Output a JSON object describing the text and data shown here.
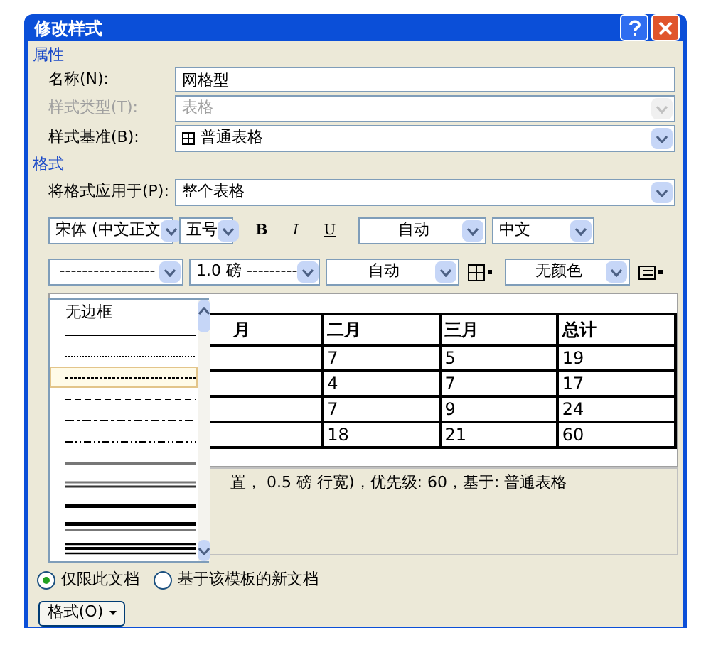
{
  "window": {
    "title": "修改样式"
  },
  "properties": {
    "heading": "属性",
    "name": {
      "label": "名称(N):",
      "value": "网格型"
    },
    "style_type": {
      "label": "样式类型(T):",
      "value": "表格",
      "disabled": true
    },
    "based_on": {
      "label": "样式基准(B):",
      "value": "普通表格"
    }
  },
  "format": {
    "heading": "格式",
    "apply_to": {
      "label": "将格式应用于(P):",
      "value": "整个表格"
    }
  },
  "toolbar": {
    "font": "宋体 (中文正文",
    "size": "五号",
    "bold": "B",
    "italic": "I",
    "underline": "U",
    "text_color": "自动",
    "language": "中文"
  },
  "border_bar": {
    "line_style": "-----------------",
    "width": "1.0 磅 ---------",
    "border_color": "自动",
    "shading": "无颜色"
  },
  "line_style_list": [
    {
      "kind": "text",
      "label": "无边框",
      "selected": false
    },
    {
      "kind": "line",
      "selected": false
    },
    {
      "kind": "line",
      "selected": false
    },
    {
      "kind": "line",
      "selected": true
    },
    {
      "kind": "line",
      "selected": false
    },
    {
      "kind": "line",
      "selected": false
    },
    {
      "kind": "line",
      "selected": false
    },
    {
      "kind": "line",
      "selected": false
    },
    {
      "kind": "line",
      "selected": false
    },
    {
      "kind": "line",
      "selected": false
    },
    {
      "kind": "line",
      "selected": false
    },
    {
      "kind": "line",
      "selected": false
    }
  ],
  "preview_table": {
    "columns": [
      "月",
      "二月",
      "三月",
      "总计"
    ],
    "rows": [
      [
        "",
        "7",
        "5",
        "19"
      ],
      [
        "",
        "4",
        "7",
        "17"
      ],
      [
        "",
        "7",
        "9",
        "24"
      ],
      [
        "",
        "18",
        "21",
        "60"
      ]
    ]
  },
  "description": "置， 0.5 磅 行宽)，优先级: 60，基于: 普通表格",
  "scope": [
    {
      "label": "仅限此文档",
      "selected": true
    },
    {
      "label": "基于该模板的新文档",
      "selected": false
    }
  ],
  "format_button": "格式(O)"
}
